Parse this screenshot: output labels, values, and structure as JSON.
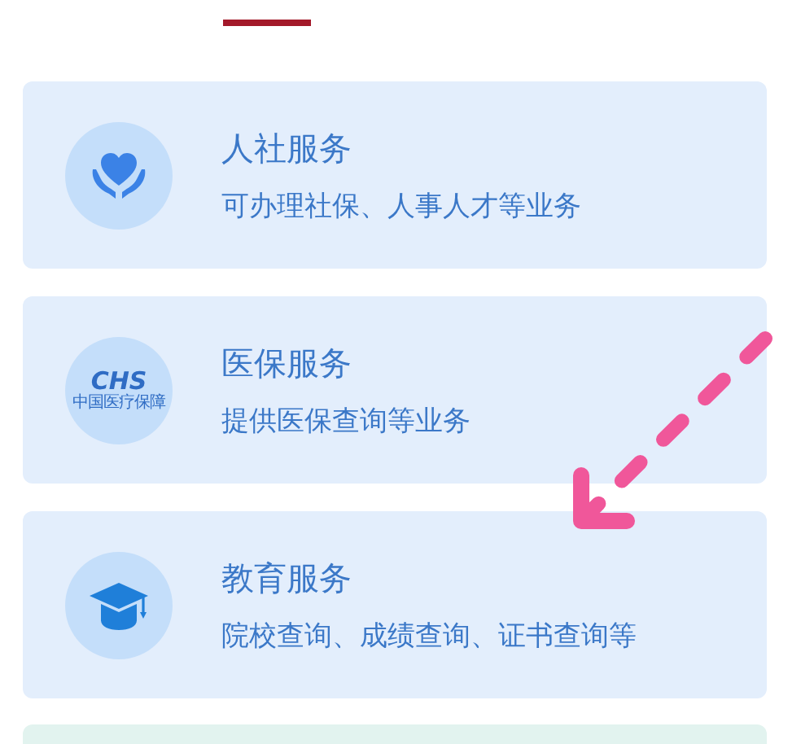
{
  "services": [
    {
      "kind": "heart",
      "title": "人社服务",
      "description": "可办理社保、人事人才等业务"
    },
    {
      "kind": "logo",
      "logo_text": "CHS",
      "logo_caption": "中国医疗保障",
      "title": "医保服务",
      "description": "提供医保查询等业务"
    },
    {
      "kind": "cap",
      "title": "教育服务",
      "description": "院校查询、成绩查询、证书查询等"
    }
  ]
}
